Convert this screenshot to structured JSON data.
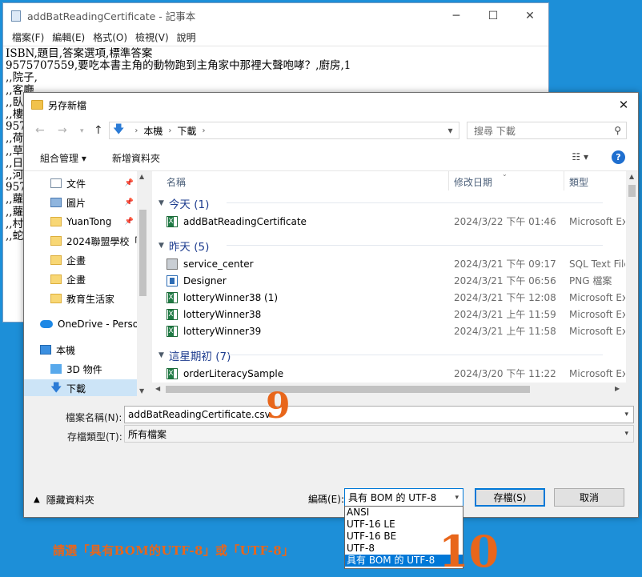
{
  "notepad": {
    "title": "addBatReadingCertificate - 記事本",
    "menu": [
      "檔案(F)",
      "編輯(E)",
      "格式(O)",
      "檢視(V)",
      "說明"
    ],
    "caption_buttons": [
      "─",
      "☐",
      "✕"
    ],
    "lines": [
      "ISBN,題目,答案選項,標準答案",
      "9575707559,要吃本書主角的動物跑到主角家中那裡大聲咆哮？,廚房,1",
      ",,院子,",
      ",,客廳,",
      ",,臥",
      ",,樓",
      "957",
      ",,荷",
      ",,草",
      ",,日",
      ",,河",
      "957",
      ",,蘿",
      ",,蘿",
      ",,村",
      ",,蛇"
    ]
  },
  "dialog": {
    "title": "另存新檔",
    "close": "✕",
    "nav": {
      "back": "←",
      "forward": "→",
      "up": "↑"
    },
    "breadcrumb": [
      "本機",
      "下載"
    ],
    "search_placeholder": "搜尋 下載",
    "toolbar": {
      "organize": "組合管理",
      "new_folder": "新增資料夾"
    },
    "help": "?",
    "sidebar": [
      {
        "icon": "document",
        "label": "文件",
        "pinned": true
      },
      {
        "icon": "picture",
        "label": "圖片",
        "pinned": true
      },
      {
        "icon": "folder",
        "label": "YuanTong",
        "pinned": true
      },
      {
        "icon": "folder",
        "label": "2024聯盟學校「",
        "pinned": false
      },
      {
        "icon": "folder",
        "label": "企畫",
        "pinned": false
      },
      {
        "icon": "folder",
        "label": "企畫",
        "pinned": false
      },
      {
        "icon": "folder",
        "label": "教育生活家",
        "pinned": false
      },
      {
        "icon": "onedrive",
        "label": "OneDrive - Perso",
        "pinned": false
      },
      {
        "icon": "pc",
        "label": "本機",
        "pinned": false
      },
      {
        "icon": "cube",
        "label": "3D 物件",
        "pinned": false
      },
      {
        "icon": "download",
        "label": "下載",
        "pinned": false
      }
    ],
    "columns": {
      "name": "名稱",
      "date": "修改日期",
      "type": "類型"
    },
    "groups": [
      {
        "label": "今天 (1)",
        "files": [
          {
            "icon": "excel",
            "name": "addBatReadingCertificate",
            "date": "2024/3/22 下午 01:46",
            "type": "Microsoft Ex"
          }
        ]
      },
      {
        "label": "昨天 (5)",
        "files": [
          {
            "icon": "sql",
            "name": "service_center",
            "date": "2024/3/21 下午 09:17",
            "type": "SQL Text File"
          },
          {
            "icon": "png",
            "name": "Designer",
            "date": "2024/3/21 下午 06:56",
            "type": "PNG 檔案"
          },
          {
            "icon": "excel",
            "name": "lotteryWinner38 (1)",
            "date": "2024/3/21 下午 12:08",
            "type": "Microsoft Ex"
          },
          {
            "icon": "excel",
            "name": "lotteryWinner38",
            "date": "2024/3/21 上午 11:59",
            "type": "Microsoft Ex"
          },
          {
            "icon": "excel",
            "name": "lotteryWinner39",
            "date": "2024/3/21 上午 11:58",
            "type": "Microsoft Ex"
          }
        ]
      },
      {
        "label": "這星期初 (7)",
        "files": [
          {
            "icon": "excel",
            "name": "orderLiteracySample",
            "date": "2024/3/20 下午 11:22",
            "type": "Microsoft Ex"
          }
        ]
      }
    ],
    "filename_label": "檔案名稱(N):",
    "filename_value": "addBatReadingCertificate.csv",
    "filetype_label": "存檔類型(T):",
    "filetype_value": "所有檔案",
    "hide_folders": "隱藏資料夾",
    "encoding_label": "編碼(E):",
    "encoding_value": "具有 BOM 的 UTF-8",
    "encoding_options": [
      "ANSI",
      "UTF-16 LE",
      "UTF-16 BE",
      "UTF-8",
      "具有 BOM 的 UTF-8"
    ],
    "save": "存檔(S)",
    "cancel": "取消"
  },
  "annotations": {
    "step9": "9",
    "step10": "10",
    "note": "請選「具有BOM的UTF-8」或「UTF-8」"
  },
  "colors": {
    "accent": "#0078d7",
    "annotation": "#e8661b",
    "desktop": "#1d8fd8"
  }
}
